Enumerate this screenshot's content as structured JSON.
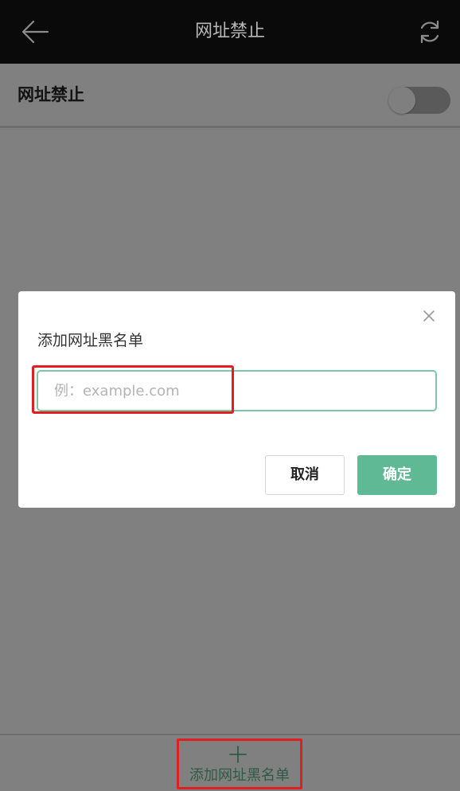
{
  "header": {
    "title": "网址禁止",
    "back_icon": "arrow-left-icon",
    "refresh_icon": "refresh-icon"
  },
  "setting": {
    "label": "网址禁止",
    "toggle_on": false
  },
  "dialog": {
    "title": "添加网址黑名单",
    "input": {
      "value": "",
      "placeholder": "例：example.com"
    },
    "cancel_label": "取消",
    "confirm_label": "确定",
    "close_icon": "close-icon"
  },
  "footer": {
    "add_label": "添加网址黑名单",
    "add_icon": "plus-icon"
  },
  "colors": {
    "accent": "#5fb994",
    "input_border": "#7cc6a6",
    "highlight": "#e02020",
    "overlay": "#808080",
    "topbar": "#0a0a0a"
  }
}
